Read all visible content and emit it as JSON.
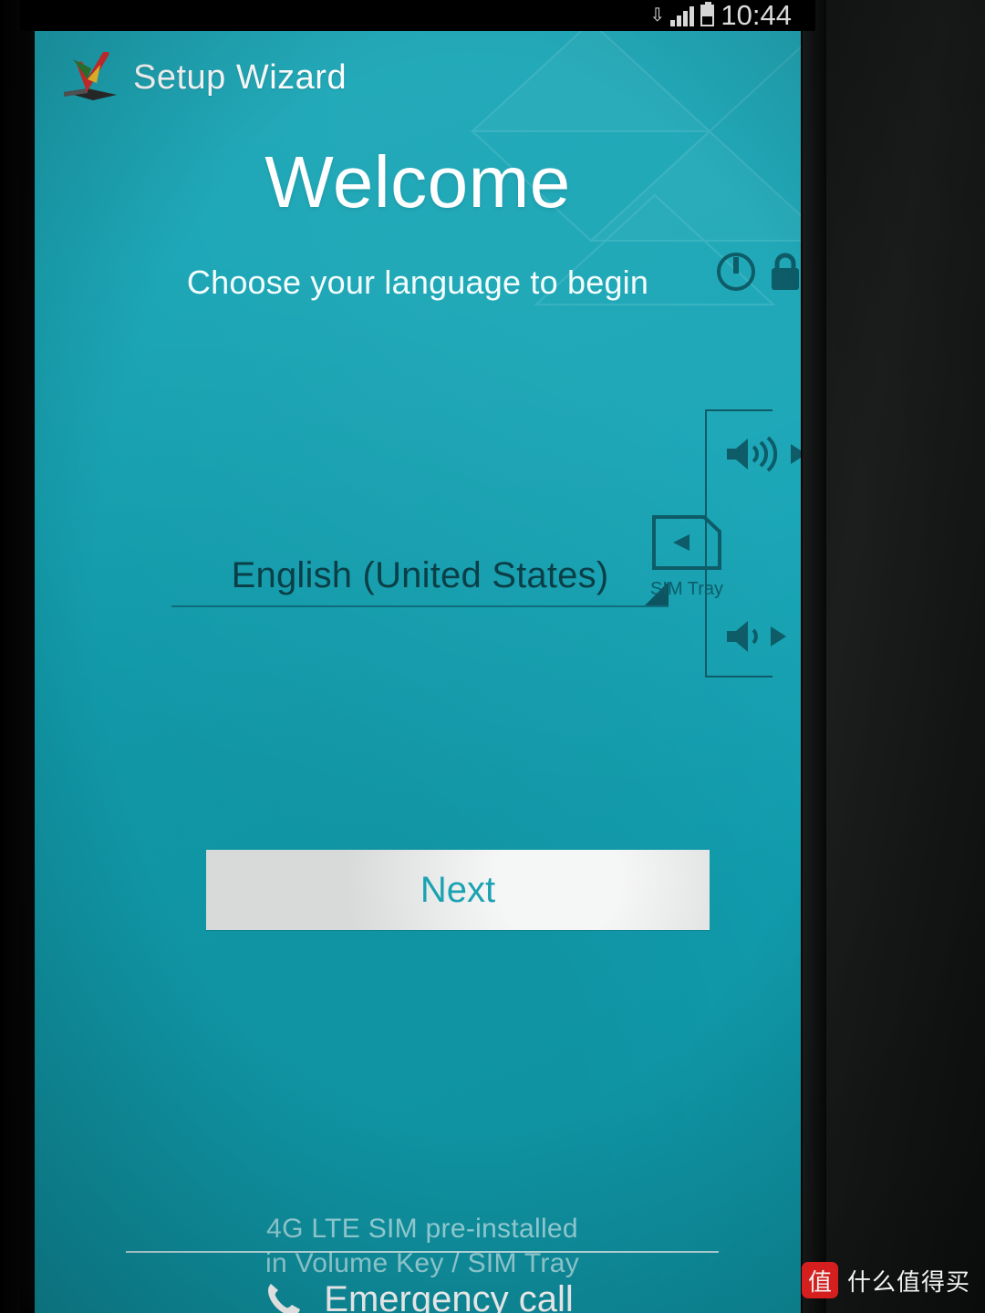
{
  "status_bar": {
    "clock": "10:44",
    "icons": [
      "download-arrow-icon",
      "signal-bars-icon",
      "battery-icon"
    ]
  },
  "header": {
    "title": "Setup Wizard",
    "logo_icon": "setup-wizard-logo-icon"
  },
  "main": {
    "heading": "Welcome",
    "subtitle": "Choose your language to begin",
    "language_value": "English (United States)",
    "language_caret_icon": "spinner-caret-icon",
    "next_label": "Next"
  },
  "footer": {
    "emergency_label": "Emergency call",
    "phone_icon": "phone-handset-icon"
  },
  "film_overlay": {
    "sticker_line1": "4G LTE SIM pre-installed",
    "sticker_line2": "in Volume Key / SIM Tray",
    "power_icon": "power-button-icon",
    "lock_icon": "lock-icon",
    "volume_up_icon": "volume-up-icon",
    "volume_down_icon": "volume-down-icon",
    "sim_tray_icon": "sim-tray-icon",
    "sim_tray_label": "SIM Tray",
    "arrow_icon": "triangle-right-icon"
  },
  "watermark": {
    "badge_text": "值",
    "text": "什么值得买"
  },
  "colors": {
    "screen_teal": "#12a3b4",
    "button_grey": "#d8dada",
    "button_text": "#1aa2b3",
    "overlay_dark_teal": "#0d5c68",
    "watermark_red": "#e02020"
  }
}
